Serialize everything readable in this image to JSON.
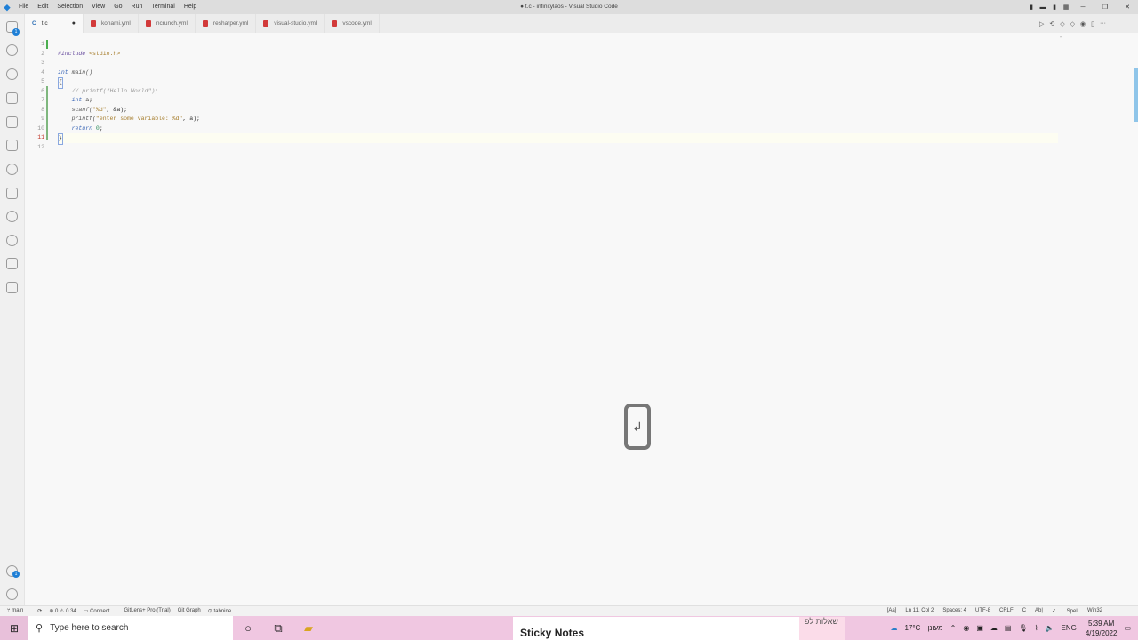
{
  "titlebar": {
    "menu": [
      "File",
      "Edit",
      "Selection",
      "View",
      "Go",
      "Run",
      "Terminal",
      "Help"
    ],
    "title": "● t.c - infinitylaos - Visual Studio Code"
  },
  "tabs": [
    {
      "label": "t.c",
      "active": true,
      "modified": true
    },
    {
      "label": "konami.yml"
    },
    {
      "label": "ncrunch.yml"
    },
    {
      "label": "resharper.yml"
    },
    {
      "label": "visual-studio.yml"
    },
    {
      "label": "vscode.yml"
    }
  ],
  "activity": {
    "explorer_badge": "1",
    "accounts_badge": "1"
  },
  "editor": {
    "breadcrumb": "...",
    "line_numbers": [
      "1",
      "2",
      "3",
      "4",
      "5",
      "6",
      "7",
      "8",
      "9",
      "10",
      "11",
      "12"
    ],
    "current_line": 11,
    "lines": {
      "l2_pre": "#include",
      "l2_str": " <stdio.h>",
      "l4_kw": "int",
      "l4_rest": " main()",
      "l5": "{",
      "l6": "    // printf(\"Hello World\");",
      "l7_kw": "int",
      "l7_rest": " a;",
      "l8_fn": "scanf(",
      "l8_str": "\"%d\"",
      "l8_rest": ", &a);",
      "l9_fn": "printf(",
      "l9_str": "\"enter some variable: %d\"",
      "l9_rest": ", a);",
      "l10_kw": "return",
      "l10_num": " 0",
      "l10_rest": ";",
      "l11": "}"
    }
  },
  "overlay": {
    "enter_glyph": "↲"
  },
  "statusbar": {
    "branch": "main",
    "problems": "⊗ 0 ⚠ 0 34",
    "connect": "Connect",
    "gitlens": "GitLens+ Pro (Trial)",
    "gitgraph": "Git Graph",
    "tabnine": "tabnine",
    "aa": "[Aa]",
    "position": "Ln 11, Col 2",
    "spaces": "Spaces: 4",
    "encoding": "UTF-8",
    "eol": "CRLF",
    "language": "C",
    "abc": "Ab|",
    "spell": "Spell",
    "platform": "Win32"
  },
  "taskbar": {
    "search_placeholder": "Type here to search",
    "sticky_title": "Sticky Notes",
    "hebrew_tab": "שאלות לפ",
    "weather": "17°C",
    "weather_label": "מעונן",
    "lang": "ENG",
    "time": "5:39 AM",
    "date": "4/19/2022"
  }
}
